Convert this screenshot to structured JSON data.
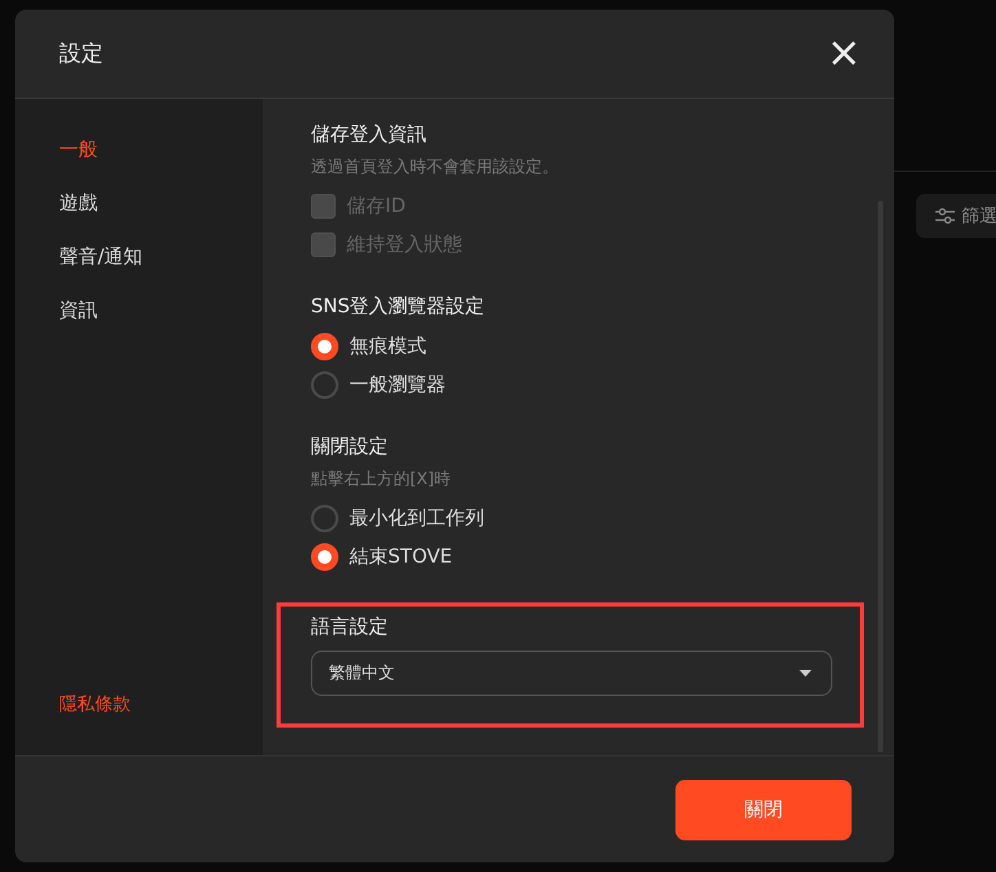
{
  "background": {
    "filter_button": {
      "label": "篩選"
    }
  },
  "dialog": {
    "title": "設定",
    "close_label": "×",
    "sidebar": {
      "items": [
        {
          "label": "一般",
          "selected": true
        },
        {
          "label": "遊戲",
          "selected": false
        },
        {
          "label": "聲音/通知",
          "selected": false
        },
        {
          "label": "資訊",
          "selected": false
        }
      ],
      "footer_link": "隱私條款"
    },
    "sections": [
      {
        "title": "儲存登入資訊",
        "note": "透過首頁登入時不會套用該設定。",
        "highlighted": false,
        "options": [
          {
            "kind": "checkbox",
            "label": "儲存ID",
            "checked": false,
            "disabled": true
          },
          {
            "kind": "checkbox",
            "label": "維持登入狀態",
            "checked": false,
            "disabled": true
          }
        ]
      },
      {
        "title": "SNS登入瀏覽器設定",
        "highlighted": false,
        "options": [
          {
            "kind": "radio",
            "label": "無痕模式",
            "selected": true
          },
          {
            "kind": "radio",
            "label": "一般瀏覽器",
            "selected": false
          }
        ]
      },
      {
        "title": "關閉設定",
        "note": "點擊右上方的[X]時",
        "highlighted": false,
        "options": [
          {
            "kind": "radio",
            "label": "最小化到工作列",
            "selected": false
          },
          {
            "kind": "radio",
            "label": "結束STOVE",
            "selected": true
          }
        ]
      },
      {
        "title": "語言設定",
        "highlighted": true,
        "dropdown": {
          "value": "繁體中文"
        }
      }
    ],
    "footer_button": "關閉"
  }
}
